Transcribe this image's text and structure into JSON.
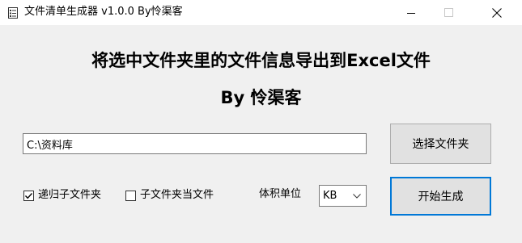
{
  "window": {
    "title": "文件清单生成器 v1.0.0 By怜渠客",
    "icon": "document-list-icon",
    "controls": {
      "minimize": "minimize-icon",
      "maximize": "maximize-icon",
      "close": "close-icon"
    }
  },
  "header": {
    "line1": "将选中文件夹里的文件信息导出到Excel文件",
    "line2": "By 怜渠客"
  },
  "folder": {
    "path_value": "C:\\资料库",
    "select_button": "选择文件夹"
  },
  "options": {
    "recursive": {
      "label": "递归子文件夹",
      "checked": true
    },
    "subfolder_as_file": {
      "label": "子文件夹当文件",
      "checked": false
    }
  },
  "size_unit": {
    "label": "体积单位",
    "selected": "KB"
  },
  "actions": {
    "start_button": "开始生成"
  },
  "colors": {
    "accent": "#0078d7",
    "background": "#f0f0f0"
  }
}
